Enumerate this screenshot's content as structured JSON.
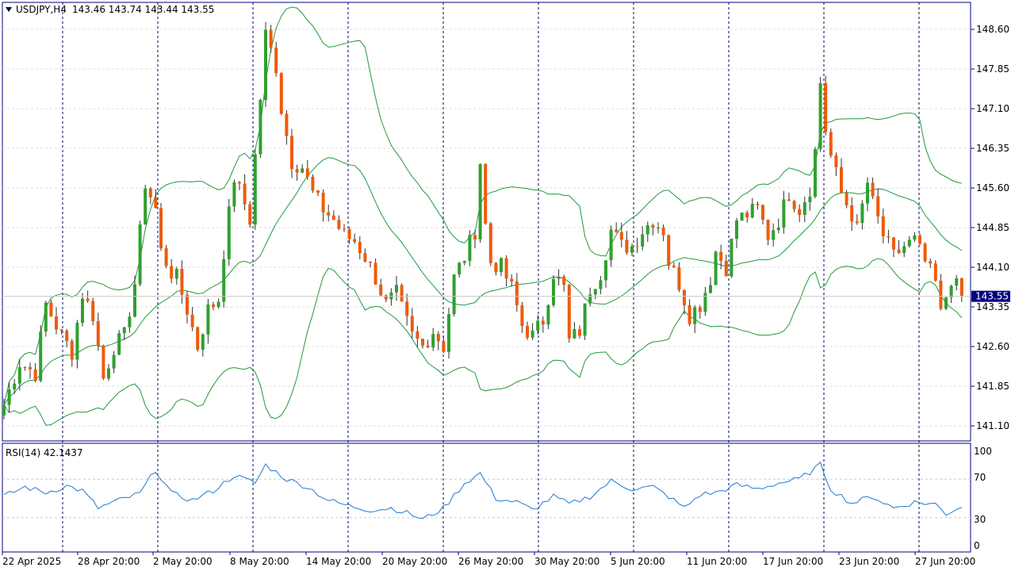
{
  "header": {
    "symbol": "USDJPY,H4",
    "ohlc": "143.46 143.74 143.44 143.55"
  },
  "price_axis": {
    "labels": [
      "148.60",
      "147.85",
      "147.10",
      "146.35",
      "145.60",
      "144.85",
      "144.10",
      "143.35",
      "142.60",
      "141.85",
      "141.10"
    ],
    "current_price": "143.55"
  },
  "rsi": {
    "label": "RSI(14) 42.1437",
    "levels": [
      "100",
      "70",
      "30",
      "0"
    ]
  },
  "time_axis": {
    "labels": [
      "22 Apr 2025",
      "28 Apr 20:00",
      "2 May 20:00",
      "8 May 20:00",
      "14 May 20:00",
      "20 May 20:00",
      "26 May 20:00",
      "30 May 20:00",
      "5 Jun 20:00",
      "11 Jun 20:00",
      "17 Jun 20:00",
      "23 Jun 20:00",
      "27 Jun 20:00"
    ]
  },
  "colors": {
    "bull": "#2fa02f",
    "bear": "#f05a0a",
    "bands": "#1e9a3c",
    "rsi": "#1e78d2",
    "axis": "#0000a0",
    "separator": "#000080",
    "price_tag": "#000080"
  },
  "chart_data": {
    "type": "candlestick",
    "instrument": "USDJPY",
    "timeframe": "H4",
    "indicators": [
      "Bollinger Bands",
      "RSI(14)"
    ],
    "ylim": [
      140.8,
      149.0
    ],
    "rsi_ylim": [
      0,
      100
    ],
    "last": 143.55,
    "close_path": [
      [
        0,
        141.5
      ],
      [
        3,
        142.3
      ],
      [
        6,
        142.1
      ],
      [
        8,
        143.4
      ],
      [
        11,
        142.8
      ],
      [
        13,
        142.5
      ],
      [
        15,
        143.6
      ],
      [
        17,
        143.2
      ],
      [
        19,
        142.0
      ],
      [
        21,
        142.6
      ],
      [
        23,
        142.8
      ],
      [
        25,
        143.8
      ],
      [
        27,
        145.7
      ],
      [
        29,
        145.2
      ],
      [
        30,
        144.4
      ],
      [
        32,
        144.0
      ],
      [
        33,
        143.9
      ],
      [
        35,
        143.3
      ],
      [
        37,
        142.6
      ],
      [
        39,
        143.3
      ],
      [
        41,
        143.5
      ],
      [
        42,
        144.4
      ],
      [
        44,
        145.8
      ],
      [
        46,
        145.3
      ],
      [
        47,
        145.0
      ],
      [
        48,
        146.2
      ],
      [
        49,
        147.3
      ],
      [
        50,
        148.5
      ],
      [
        51,
        148.2
      ],
      [
        52,
        147.9
      ],
      [
        53,
        147.1
      ],
      [
        55,
        146.1
      ],
      [
        57,
        146.0
      ],
      [
        59,
        145.5
      ],
      [
        61,
        145.2
      ],
      [
        63,
        145.0
      ],
      [
        65,
        144.7
      ],
      [
        67,
        144.6
      ],
      [
        69,
        144.3
      ],
      [
        71,
        143.9
      ],
      [
        73,
        143.4
      ],
      [
        75,
        143.6
      ],
      [
        76,
        143.3
      ],
      [
        78,
        142.8
      ],
      [
        80,
        142.6
      ],
      [
        82,
        142.9
      ],
      [
        84,
        142.6
      ],
      [
        86,
        143.9
      ],
      [
        88,
        144.3
      ],
      [
        90,
        144.8
      ],
      [
        91,
        146.1
      ],
      [
        92,
        144.9
      ],
      [
        93,
        144.2
      ],
      [
        95,
        144.1
      ],
      [
        97,
        143.7
      ],
      [
        99,
        143.0
      ],
      [
        101,
        142.8
      ],
      [
        103,
        143.1
      ],
      [
        105,
        144.0
      ],
      [
        107,
        143.7
      ],
      [
        108,
        142.7
      ],
      [
        110,
        142.9
      ],
      [
        112,
        143.7
      ],
      [
        114,
        144.0
      ],
      [
        116,
        144.8
      ],
      [
        118,
        144.5
      ],
      [
        120,
        144.5
      ],
      [
        122,
        144.8
      ],
      [
        124,
        145.0
      ],
      [
        126,
        144.8
      ],
      [
        127,
        144.2
      ],
      [
        129,
        143.8
      ],
      [
        131,
        143.2
      ],
      [
        133,
        143.4
      ],
      [
        135,
        143.9
      ],
      [
        136,
        144.4
      ],
      [
        138,
        144.1
      ],
      [
        140,
        145.0
      ],
      [
        142,
        145.1
      ],
      [
        144,
        145.2
      ],
      [
        146,
        144.7
      ],
      [
        148,
        145.0
      ],
      [
        150,
        145.5
      ],
      [
        152,
        145.2
      ],
      [
        154,
        145.6
      ],
      [
        155,
        146.3
      ],
      [
        156,
        147.6
      ],
      [
        157,
        146.7
      ],
      [
        158,
        146.2
      ],
      [
        160,
        145.5
      ],
      [
        162,
        145.1
      ],
      [
        163,
        144.8
      ],
      [
        165,
        145.7
      ],
      [
        166,
        145.3
      ],
      [
        168,
        144.7
      ],
      [
        170,
        144.3
      ],
      [
        172,
        144.5
      ],
      [
        174,
        144.6
      ],
      [
        176,
        144.2
      ],
      [
        178,
        143.8
      ],
      [
        179,
        143.2
      ],
      [
        181,
        143.9
      ],
      [
        183,
        143.55
      ]
    ],
    "rsi_path": [
      [
        0,
        52
      ],
      [
        4,
        62
      ],
      [
        8,
        56
      ],
      [
        12,
        63
      ],
      [
        15,
        58
      ],
      [
        18,
        40
      ],
      [
        22,
        48
      ],
      [
        26,
        55
      ],
      [
        29,
        80
      ],
      [
        32,
        55
      ],
      [
        36,
        48
      ],
      [
        40,
        58
      ],
      [
        44,
        74
      ],
      [
        48,
        66
      ],
      [
        50,
        85
      ],
      [
        54,
        70
      ],
      [
        58,
        62
      ],
      [
        62,
        48
      ],
      [
        66,
        42
      ],
      [
        70,
        38
      ],
      [
        74,
        40
      ],
      [
        78,
        33
      ],
      [
        80,
        28
      ],
      [
        84,
        40
      ],
      [
        88,
        66
      ],
      [
        91,
        76
      ],
      [
        94,
        50
      ],
      [
        98,
        46
      ],
      [
        101,
        38
      ],
      [
        105,
        52
      ],
      [
        108,
        44
      ],
      [
        112,
        52
      ],
      [
        116,
        68
      ],
      [
        120,
        60
      ],
      [
        124,
        62
      ],
      [
        127,
        52
      ],
      [
        130,
        40
      ],
      [
        133,
        54
      ],
      [
        136,
        56
      ],
      [
        140,
        64
      ],
      [
        144,
        60
      ],
      [
        148,
        66
      ],
      [
        152,
        70
      ],
      [
        156,
        85
      ],
      [
        158,
        60
      ],
      [
        162,
        45
      ],
      [
        166,
        52
      ],
      [
        170,
        40
      ],
      [
        174,
        46
      ],
      [
        178,
        44
      ],
      [
        180,
        34
      ],
      [
        183,
        42
      ]
    ]
  }
}
